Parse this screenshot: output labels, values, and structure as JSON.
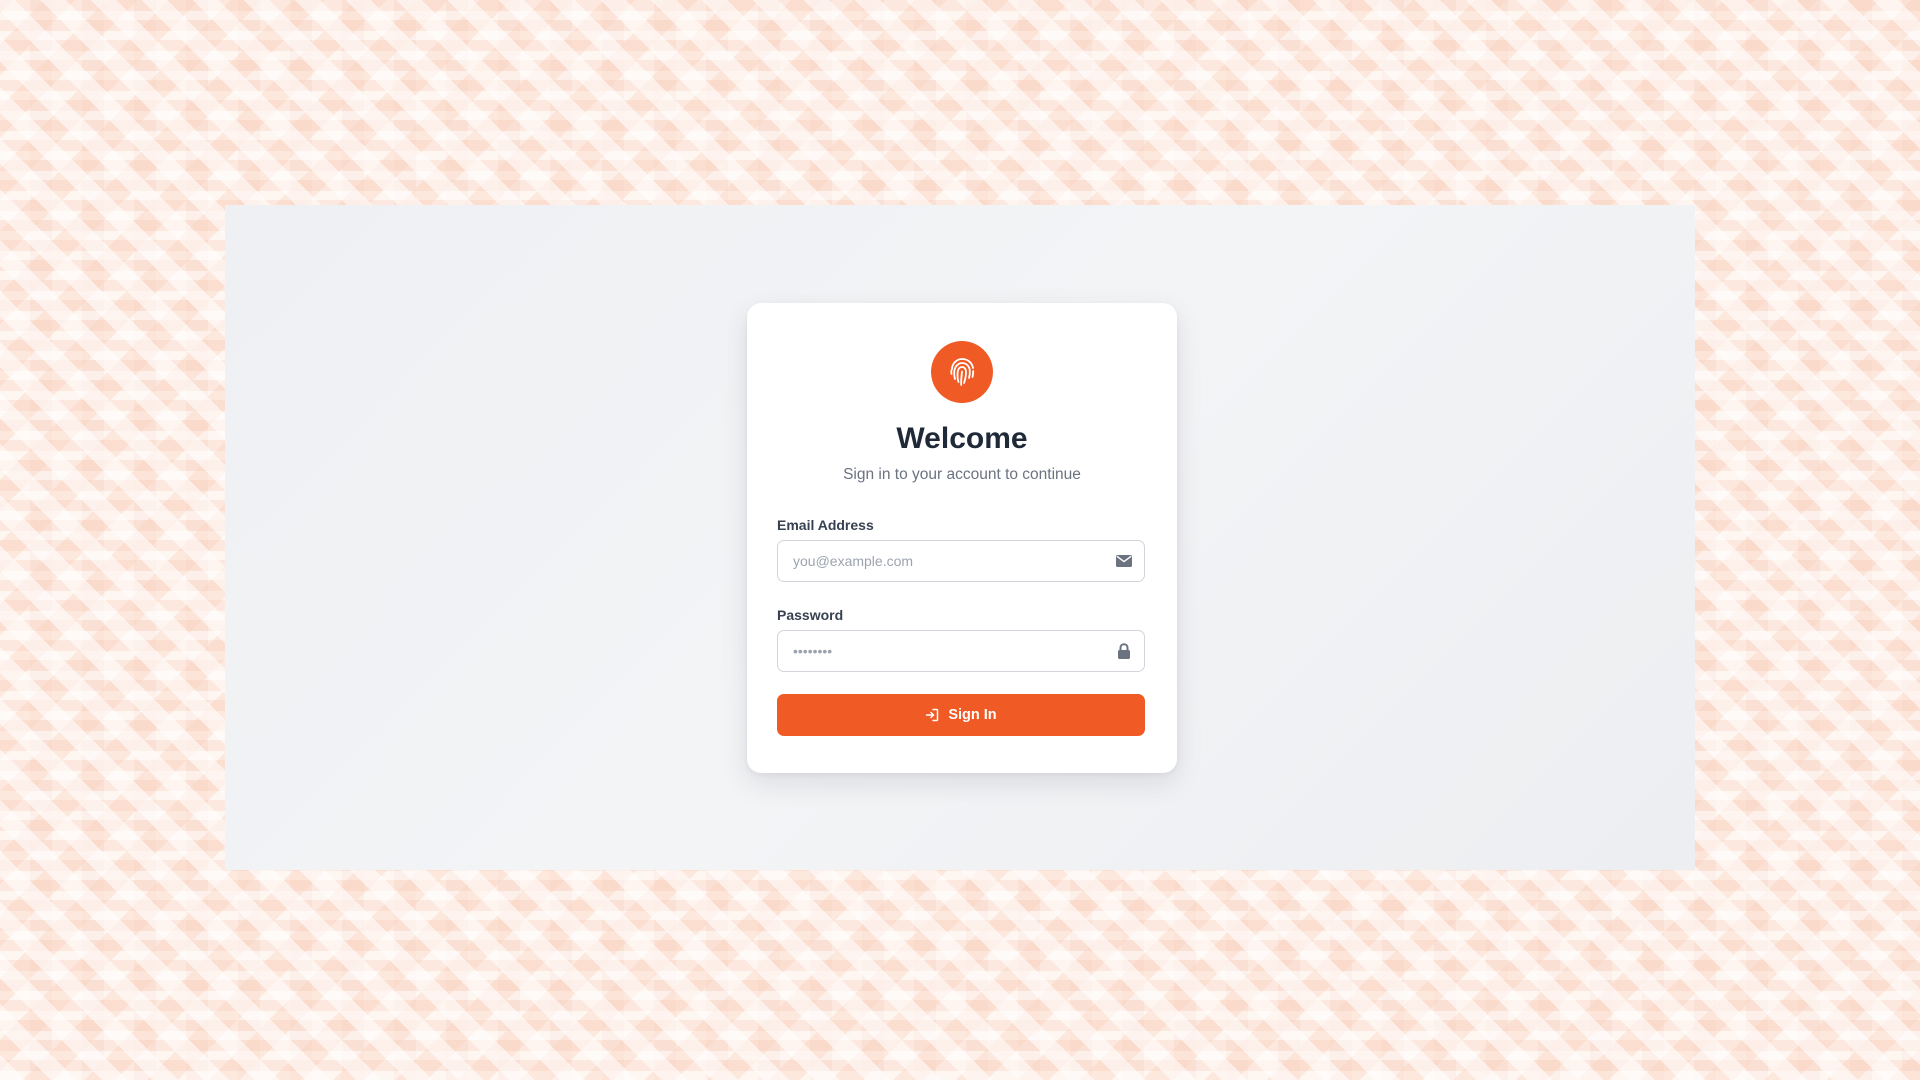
{
  "colors": {
    "accent": "#f05a24",
    "title": "#1f2937",
    "muted": "#6b7280",
    "icon": "#6b7280"
  },
  "login": {
    "logo_icon": "fingerprint-icon",
    "title": "Welcome",
    "subtitle": "Sign in to your account to continue",
    "email": {
      "label": "Email Address",
      "placeholder": "you@example.com",
      "value": "",
      "icon": "envelope-icon"
    },
    "password": {
      "label": "Password",
      "placeholder": "••••••••",
      "value": "",
      "icon": "lock-icon"
    },
    "submit": {
      "label": "Sign In",
      "icon": "sign-in-icon"
    }
  }
}
